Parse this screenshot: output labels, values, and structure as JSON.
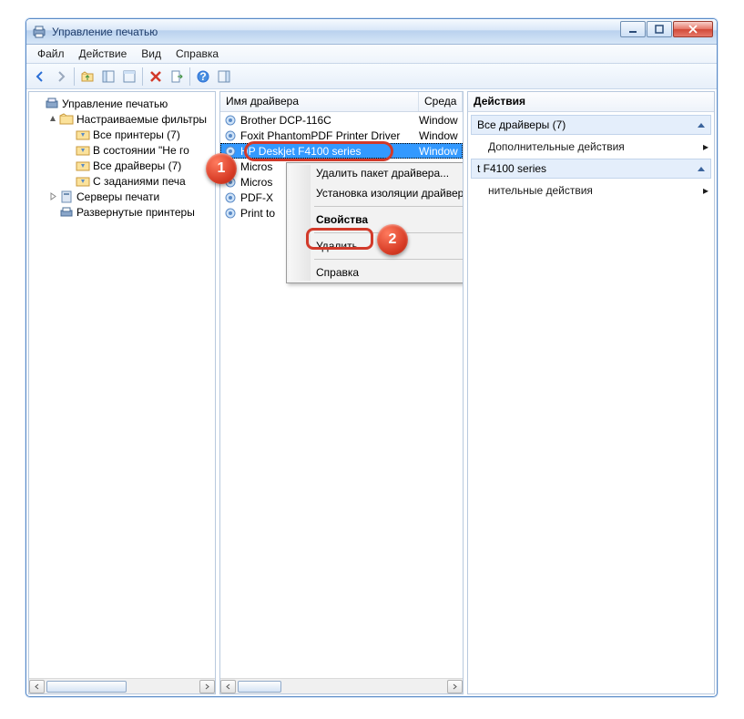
{
  "window": {
    "title": "Управление печатью"
  },
  "menu": {
    "file": "Файл",
    "action": "Действие",
    "view": "Вид",
    "help": "Справка"
  },
  "tree": {
    "root": "Управление печатью",
    "filters": "Настраиваемые фильтры",
    "all_printers": "Все принтеры (7)",
    "in_state": "В состоянии \"Не го",
    "all_drivers": "Все драйверы (7)",
    "with_jobs": "С заданиями печа",
    "servers": "Серверы печати",
    "deployed": "Развернутые принтеры"
  },
  "list": {
    "col_name": "Имя драйвера",
    "col_env": "Среда",
    "rows": [
      {
        "name": "Brother DCP-116C",
        "env": "Window"
      },
      {
        "name": "Foxit PhantomPDF Printer Driver",
        "env": "Window"
      },
      {
        "name": "HP Deskjet F4100 series",
        "env": "Window"
      },
      {
        "name": "Micros",
        "env": ""
      },
      {
        "name": "Micros",
        "env": ""
      },
      {
        "name": "PDF-X",
        "env": ""
      },
      {
        "name": "Print to",
        "env": ""
      }
    ]
  },
  "actions": {
    "header": "Действия",
    "group1": "Все драйверы (7)",
    "more1": "Дополнительные действия",
    "group2_suffix": "t F4100 series",
    "more2": "нительные действия"
  },
  "ctx": {
    "remove_pkg": "Удалить пакет драйвера...",
    "isolation": "Установка изоляции драйвера",
    "properties": "Свойства",
    "delete": "Удалить",
    "help": "Справка"
  },
  "badges": {
    "one": "1",
    "two": "2"
  }
}
